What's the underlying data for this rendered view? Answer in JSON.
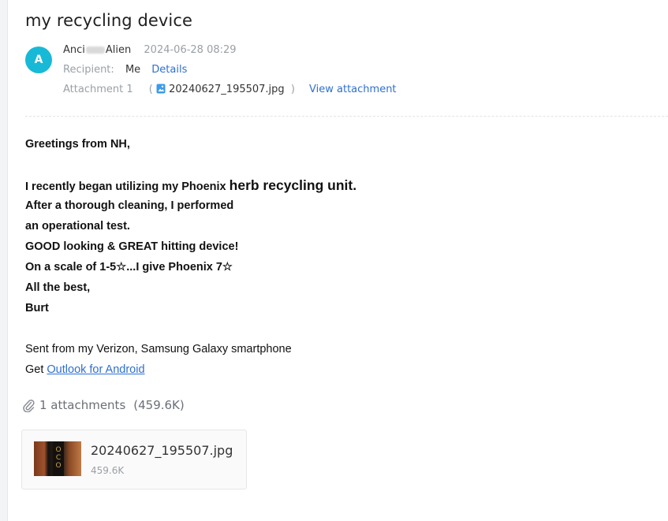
{
  "subject": "my recycling device",
  "sender": {
    "avatar_letter": "A",
    "name_part1": "Anci",
    "name_part2": "Alien",
    "date": "2024-06-28 08:29"
  },
  "recipient": {
    "label": "Recipient:",
    "value": "Me",
    "details_label": "Details"
  },
  "attachment_line": {
    "label": "Attachment 1",
    "open_paren": "(",
    "file_name": "20240627_195507.jpg",
    "close_paren": ")",
    "view_label": "View attachment"
  },
  "body": {
    "greeting": "Greetings from NH,",
    "line1_a": "I recently began utilizing my Phoenix ",
    "line1_b": "herb recycling unit.",
    "line2": "After a thorough cleaning, I performed",
    "line3": "an operational test.",
    "line4": "GOOD looking & GREAT hitting device!",
    "line5": "On a scale of 1-5☆...I give Phoenix 7☆",
    "line6": "All the best,",
    "line7": "Burt",
    "sent_from": "Sent from my Verizon, Samsung Galaxy smartphone",
    "get_prefix": "Get ",
    "get_link": "Outlook for Android"
  },
  "attachments": {
    "count_label": "1 attachments",
    "total_size": "(459.6K)",
    "items": [
      {
        "name": "20240627_195507.jpg",
        "size": "459.6K"
      }
    ]
  },
  "colors": {
    "accent": "#2f6fd1",
    "avatar": "#17b9d6"
  }
}
